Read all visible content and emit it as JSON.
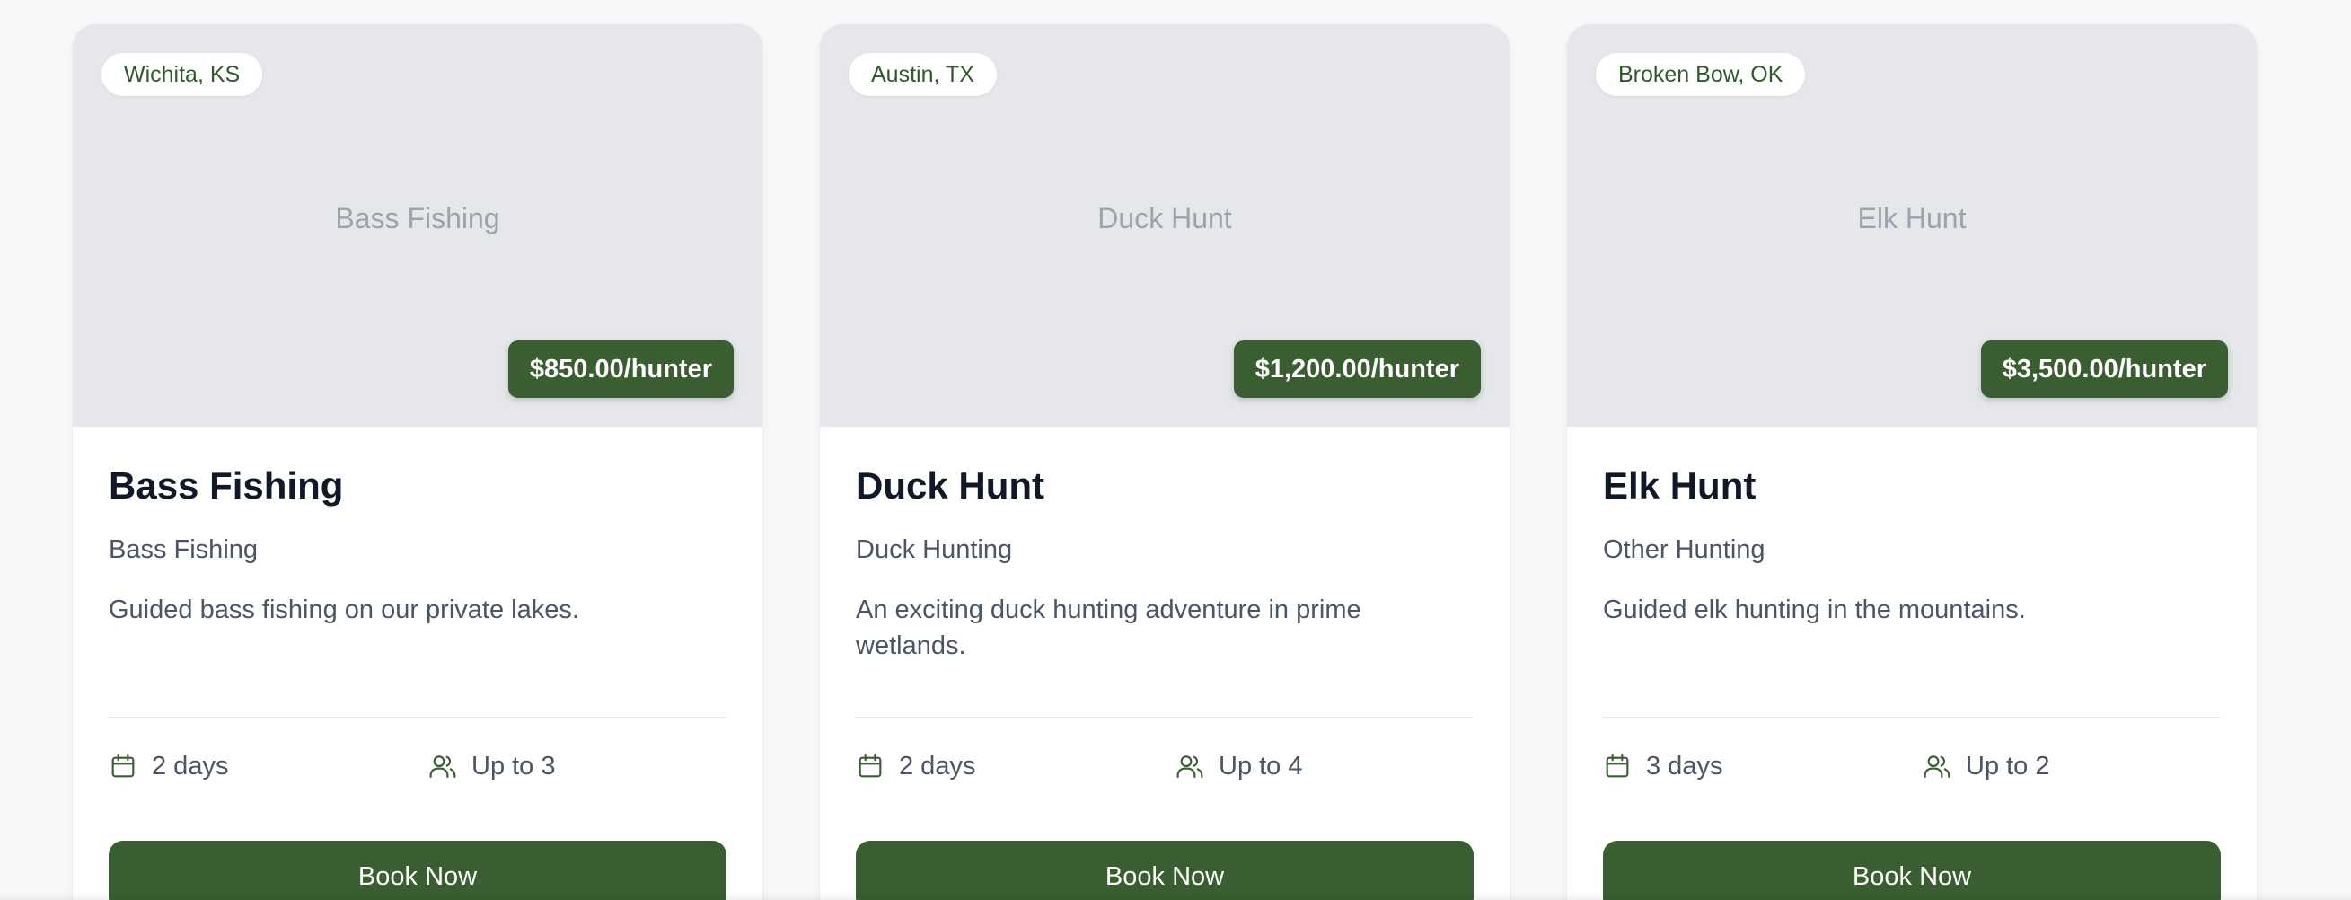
{
  "colors": {
    "brand_green": "#3a5e31",
    "location_text": "#2f5a2a",
    "media_bg": "#e5e7eb",
    "page_bg": "#f7f8fa"
  },
  "cards": [
    {
      "location": "Wichita, KS",
      "image_placeholder": "Bass Fishing",
      "price": "$850.00/hunter",
      "title": "Bass Fishing",
      "category": "Bass Fishing",
      "description": "Guided bass fishing on our private lakes.",
      "duration": "2 days",
      "capacity": "Up to 3",
      "duration_icon": "calendar-icon",
      "capacity_icon": "users-icon",
      "cta": "Book Now"
    },
    {
      "location": "Austin, TX",
      "image_placeholder": "Duck Hunt",
      "price": "$1,200.00/hunter",
      "title": "Duck Hunt",
      "category": "Duck Hunting",
      "description": "An exciting duck hunting adventure in prime wetlands.",
      "duration": "2 days",
      "capacity": "Up to 4",
      "duration_icon": "calendar-icon",
      "capacity_icon": "users-icon",
      "cta": "Book Now"
    },
    {
      "location": "Broken Bow, OK",
      "image_placeholder": "Elk Hunt",
      "price": "$3,500.00/hunter",
      "title": "Elk Hunt",
      "category": "Other Hunting",
      "description": "Guided elk hunting in the mountains.",
      "duration": "3 days",
      "capacity": "Up to 2",
      "duration_icon": "calendar-icon",
      "capacity_icon": "users-icon",
      "cta": "Book Now"
    }
  ]
}
